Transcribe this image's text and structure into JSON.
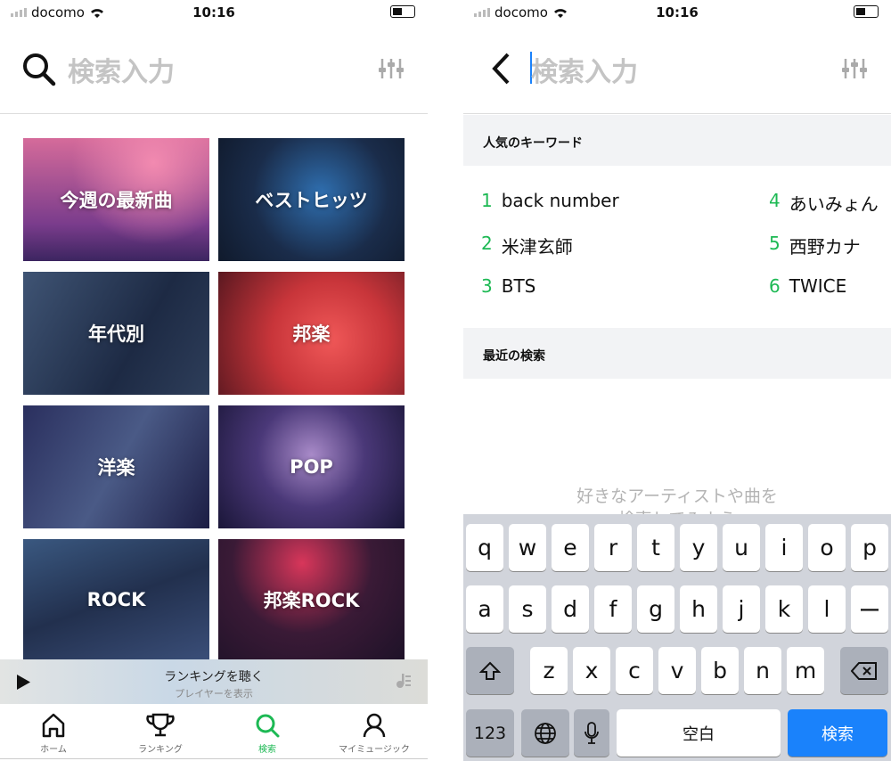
{
  "status": {
    "carrier": "docomo",
    "time": "10:16"
  },
  "left": {
    "search_placeholder": "検索入力",
    "tiles": [
      {
        "label": "今週の最新曲"
      },
      {
        "label": "ベストヒッツ"
      },
      {
        "label": "年代別"
      },
      {
        "label": "邦楽"
      },
      {
        "label": "洋楽"
      },
      {
        "label": "POP"
      },
      {
        "label": "ROCK"
      },
      {
        "label": "邦楽ROCK"
      }
    ],
    "player": {
      "title": "ランキングを聴く",
      "subtitle": "プレイヤーを表示"
    },
    "tabs": [
      {
        "label": "ホーム",
        "icon": "home-icon"
      },
      {
        "label": "ランキング",
        "icon": "trophy-icon"
      },
      {
        "label": "検索",
        "icon": "search-icon",
        "active": true
      },
      {
        "label": "マイミュージック",
        "icon": "person-icon"
      }
    ]
  },
  "right": {
    "search_placeholder": "検索入力",
    "popular_title": "人気のキーワード",
    "keywords": [
      {
        "n": "1",
        "text": "back number"
      },
      {
        "n": "2",
        "text": "米津玄師"
      },
      {
        "n": "3",
        "text": "BTS"
      },
      {
        "n": "4",
        "text": "あいみょん"
      },
      {
        "n": "5",
        "text": "西野カナ"
      },
      {
        "n": "6",
        "text": "TWICE"
      }
    ],
    "recent_title": "最近の検索",
    "empty_line1": "好きなアーティストや曲を",
    "empty_line2": "検索してみよう",
    "keyboard": {
      "row1": [
        "q",
        "w",
        "e",
        "r",
        "t",
        "y",
        "u",
        "i",
        "o",
        "p"
      ],
      "row2": [
        "a",
        "s",
        "d",
        "f",
        "g",
        "h",
        "j",
        "k",
        "l",
        "ー"
      ],
      "row3": [
        "z",
        "x",
        "c",
        "v",
        "b",
        "n",
        "m"
      ],
      "num": "123",
      "space": "空白",
      "search": "検索"
    }
  },
  "colors": {
    "accent": "#1db954",
    "keyboard_search": "#1a82fb"
  }
}
